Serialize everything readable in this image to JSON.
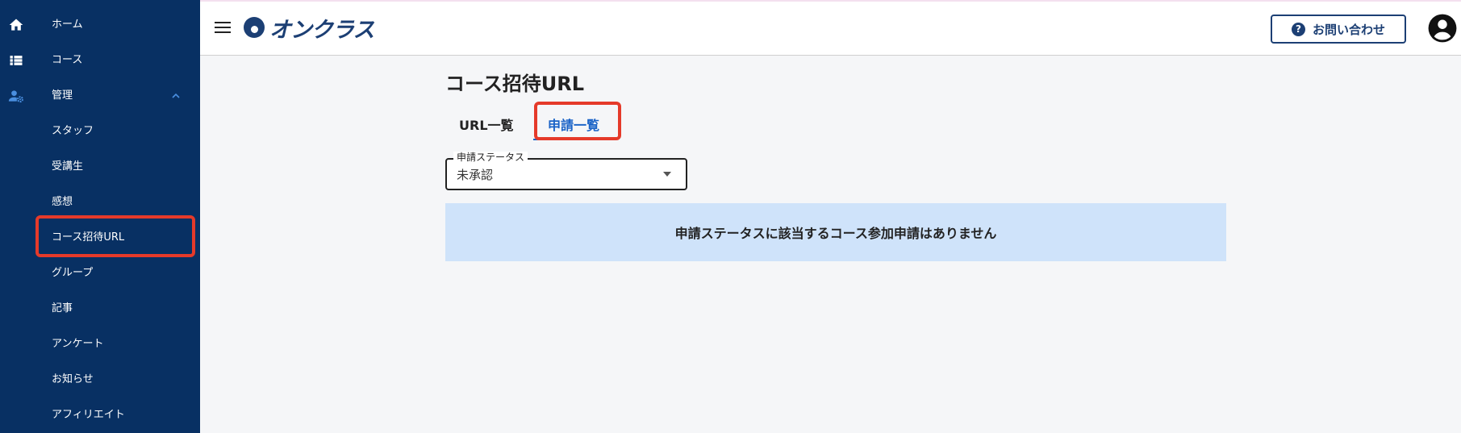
{
  "sidebar": {
    "items": [
      {
        "label": "ホーム",
        "icon": "home-icon"
      },
      {
        "label": "コース",
        "icon": "list-icon"
      },
      {
        "label": "管理",
        "icon": "admin-icon",
        "expanded": true
      },
      {
        "label": "スタッフ"
      },
      {
        "label": "受講生"
      },
      {
        "label": "感想"
      },
      {
        "label": "コース招待URL",
        "selected": true
      },
      {
        "label": "グループ"
      },
      {
        "label": "記事"
      },
      {
        "label": "アンケート"
      },
      {
        "label": "お知らせ"
      },
      {
        "label": "アフィリエイト"
      }
    ]
  },
  "header": {
    "logo_text": "オンクラス",
    "contact_label": "お問い合わせ"
  },
  "main": {
    "title": "コース招待URL",
    "tabs": [
      {
        "label": "URL一覧",
        "active": false
      },
      {
        "label": "申請一覧",
        "active": true
      }
    ],
    "status_select": {
      "label": "申請ステータス",
      "value": "未承認"
    },
    "empty_message": "申請ステータスに該当するコース参加申請はありません"
  },
  "colors": {
    "sidebar_bg": "#083063",
    "accent": "#1a63c7",
    "highlight": "#e53a2a",
    "notice_bg": "#cfe3fa"
  }
}
